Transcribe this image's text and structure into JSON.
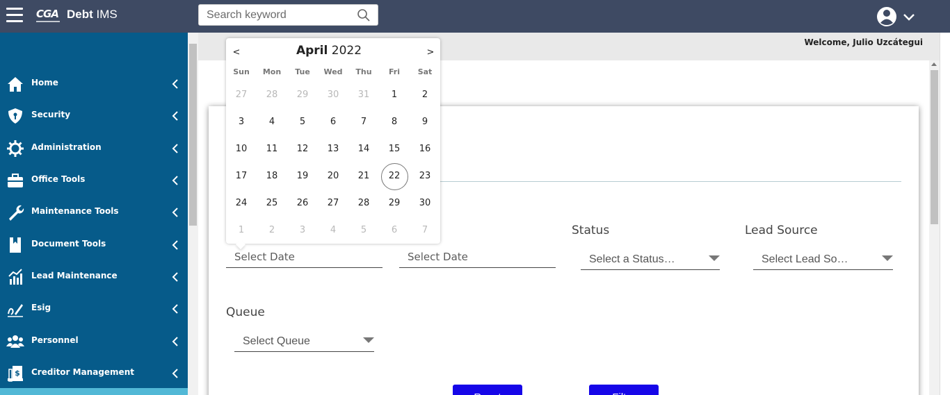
{
  "header": {
    "logo_text": "CGA",
    "app_name_bold": "Debt",
    "app_name_rest": "IMS",
    "search_placeholder": "Search keyword"
  },
  "welcome": "Welcome, Julio Uzcátegui",
  "sidebar": {
    "items": [
      {
        "label": "Home",
        "icon": "home-icon"
      },
      {
        "label": "Security",
        "icon": "shield-icon"
      },
      {
        "label": "Administration",
        "icon": "gear-icon"
      },
      {
        "label": "Office Tools",
        "icon": "briefcase-icon"
      },
      {
        "label": "Maintenance Tools",
        "icon": "wrench-icon"
      },
      {
        "label": "Document Tools",
        "icon": "book-icon"
      },
      {
        "label": "Lead Maintenance",
        "icon": "bar-chart-icon"
      },
      {
        "label": "Esig",
        "icon": "signature-icon"
      },
      {
        "label": "Personnel",
        "icon": "people-icon"
      },
      {
        "label": "Creditor Management",
        "icon": "document-dollar-icon"
      }
    ]
  },
  "form": {
    "date_from_placeholder": "Select Date",
    "date_to_placeholder": "Select Date",
    "status_label": "Status",
    "status_value": "Select a Status…",
    "lead_source_label": "Lead Source",
    "lead_source_value": "Select Lead So…",
    "queue_label": "Queue",
    "queue_value": "Select Queue",
    "reset_label": "Reset",
    "filter_label": "Filter"
  },
  "calendar": {
    "month": "April",
    "year": "2022",
    "prev_label": "<",
    "next_label": ">",
    "weekdays": [
      "Sun",
      "Mon",
      "Tue",
      "Wed",
      "Thu",
      "Fri",
      "Sat"
    ],
    "weeks": [
      [
        "27",
        "28",
        "29",
        "30",
        "31",
        "1",
        "2"
      ],
      [
        "3",
        "4",
        "5",
        "6",
        "7",
        "8",
        "9"
      ],
      [
        "10",
        "11",
        "12",
        "13",
        "14",
        "15",
        "16"
      ],
      [
        "17",
        "18",
        "19",
        "20",
        "21",
        "22",
        "23"
      ],
      [
        "24",
        "25",
        "26",
        "27",
        "28",
        "29",
        "30"
      ],
      [
        "1",
        "2",
        "3",
        "4",
        "5",
        "6",
        "7"
      ]
    ],
    "muted_first_row_count": 5,
    "muted_last_row": true,
    "today": "22"
  },
  "colors": {
    "topbar": "#3e4a63",
    "sidebar": "#065b8a",
    "button": "#1606e8"
  }
}
